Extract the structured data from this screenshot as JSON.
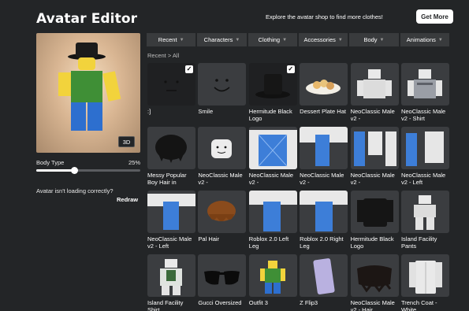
{
  "page": {
    "title": "Avatar Editor"
  },
  "promo": {
    "text": "Explore the avatar shop to find more clothes!",
    "button_label": "Get More"
  },
  "preview": {
    "view_button_label": "3D"
  },
  "body_type": {
    "label": "Body Type",
    "value_label": "25%",
    "value": 0.25
  },
  "loading": {
    "question": "Avatar isn't loading correctly?",
    "action_label": "Redraw"
  },
  "tabs": [
    {
      "label": "Recent"
    },
    {
      "label": "Characters"
    },
    {
      "label": "Clothing"
    },
    {
      "label": "Accessories"
    },
    {
      "label": "Body"
    },
    {
      "label": "Animations"
    }
  ],
  "breadcrumb": {
    "parent": "Recent",
    "separator": ">",
    "current": "All"
  },
  "items": [
    {
      "name": ":]",
      "selected": true,
      "icon": "face-smirk"
    },
    {
      "name": "Smile",
      "selected": false,
      "icon": "face-smile"
    },
    {
      "name": "Hermitude Black Logo",
      "selected": true,
      "icon": "black-hat"
    },
    {
      "name": "Dessert Plate Hat",
      "selected": false,
      "icon": "dessert-plate"
    },
    {
      "name": "NeoClassic Male v2 -",
      "selected": false,
      "icon": "torso"
    },
    {
      "name": "NeoClassic Male v2 - Shirt",
      "selected": false,
      "icon": "torso-shirt"
    },
    {
      "name": "Messy Popular Boy Hair in",
      "selected": false,
      "icon": "black-hair"
    },
    {
      "name": "NeoClassic Male v2 -",
      "selected": false,
      "icon": "head"
    },
    {
      "name": "NeoClassic Male v2 -",
      "selected": false,
      "icon": "torso-blue"
    },
    {
      "name": "NeoClassic Male v2 -",
      "selected": false,
      "icon": "arm-blue"
    },
    {
      "name": "NeoClassic Male v2 -",
      "selected": false,
      "icon": "arms-blue"
    },
    {
      "name": "NeoClassic Male v2 - Left",
      "selected": false,
      "icon": "arm-blue-left"
    },
    {
      "name": "NeoClassic Male v2 - Left",
      "selected": false,
      "icon": "leg-blue"
    },
    {
      "name": "Pal Hair",
      "selected": false,
      "icon": "brown-hair"
    },
    {
      "name": "Roblox 2.0 Left Leg",
      "selected": false,
      "icon": "leg-left"
    },
    {
      "name": "Roblox 2.0 Right Leg",
      "selected": false,
      "icon": "leg-right"
    },
    {
      "name": "Hermitude Black Logo",
      "selected": false,
      "icon": "black-jacket"
    },
    {
      "name": "Island Facility Pants",
      "selected": false,
      "icon": "pants"
    },
    {
      "name": "Island Facility Shirt",
      "selected": false,
      "icon": "shirt-figure"
    },
    {
      "name": "Gucci Oversized",
      "selected": false,
      "icon": "sunglasses"
    },
    {
      "name": "Outfit 3",
      "selected": false,
      "icon": "outfit"
    },
    {
      "name": "Z Flip3",
      "selected": false,
      "icon": "phone"
    },
    {
      "name": "NeoClassic Male v2 - Hair",
      "selected": false,
      "icon": "hair-dark"
    },
    {
      "name": "Trench Coat - White",
      "selected": false,
      "icon": "white-coat"
    }
  ],
  "colors": {
    "background": "#232527",
    "tab_bg": "#393b3d",
    "tile_bg": "#3b3d40",
    "selected_tile_bg": "#1f2022"
  }
}
